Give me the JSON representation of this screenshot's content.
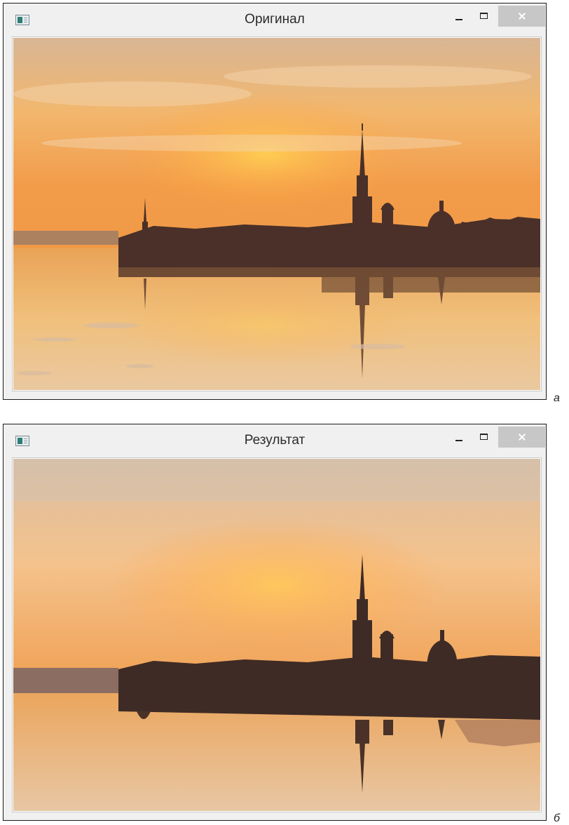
{
  "windows": [
    {
      "title": "Оригинал",
      "figure_label": "а",
      "image": {
        "subject": "Saint Petersburg skyline at sunset reflected in river",
        "variant": "original"
      }
    },
    {
      "title": "Результат",
      "figure_label": "б",
      "image": {
        "subject": "Saint Petersburg skyline at sunset reflected in river",
        "variant": "processed"
      }
    }
  ],
  "colors": {
    "titlebar_bg": "#f0f0f0",
    "close_button_bg": "#c7c7c7",
    "sky_top": "#c9a98c",
    "sky_mid": "#f0a858",
    "sun_glow": "#ffbf4a",
    "silhouette": "#3a2a24"
  },
  "icons": [
    "app-icon",
    "minimize-icon",
    "maximize-icon",
    "close-icon"
  ]
}
